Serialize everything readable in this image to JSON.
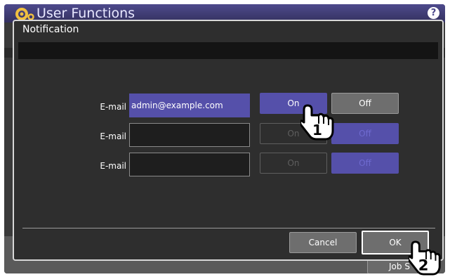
{
  "app": {
    "title": "User Functions",
    "help_glyph": "?",
    "job_status_label": "Job S"
  },
  "dialog": {
    "title": "Notification",
    "rows": [
      {
        "label": "E-mail",
        "value": "admin@example.com",
        "on_label": "On",
        "off_label": "Off"
      },
      {
        "label": "E-mail",
        "value": "",
        "on_label": "On",
        "off_label": "Off"
      },
      {
        "label": "E-mail",
        "value": "",
        "on_label": "On",
        "off_label": "Off"
      }
    ],
    "cancel_label": "Cancel",
    "ok_label": "OK"
  },
  "callouts": {
    "step1": "1",
    "step2": "2"
  },
  "colors": {
    "accent": "#5550aa",
    "dialog_bg": "#2e2e2e",
    "button_gray": "#6e6e6e"
  }
}
